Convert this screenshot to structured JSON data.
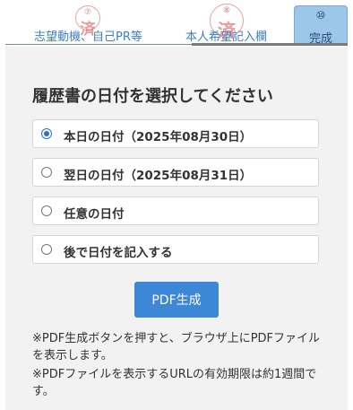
{
  "tabs": {
    "items": [
      {
        "label": "志望動機、自己PR等",
        "stamp_number": "⑦",
        "stamp_char": "済"
      },
      {
        "label": "本人希望記入欄",
        "stamp_number": "⑧",
        "stamp_char": "済"
      }
    ],
    "active": {
      "number": "⑩",
      "label": "完成"
    }
  },
  "main": {
    "title": "履歴書の日付を選択してください",
    "options": [
      {
        "label": "本日の日付（2025年08月30日）",
        "checked": true
      },
      {
        "label": "翌日の日付（2025年08月31日）",
        "checked": false
      },
      {
        "label": "任意の日付",
        "checked": false
      },
      {
        "label": "後で日付を記入する",
        "checked": false
      }
    ],
    "pdf_button_label": "PDF生成",
    "notes": [
      "※PDF生成ボタンを押すと、ブラウザ上にPDFファイルを表示します。",
      "※PDFファイルを表示するURLの有効期限は約1週間です。"
    ]
  },
  "colors": {
    "accent": "#3c88d6",
    "active_tab": "#9cc7ea",
    "stamp": "#d85656"
  }
}
